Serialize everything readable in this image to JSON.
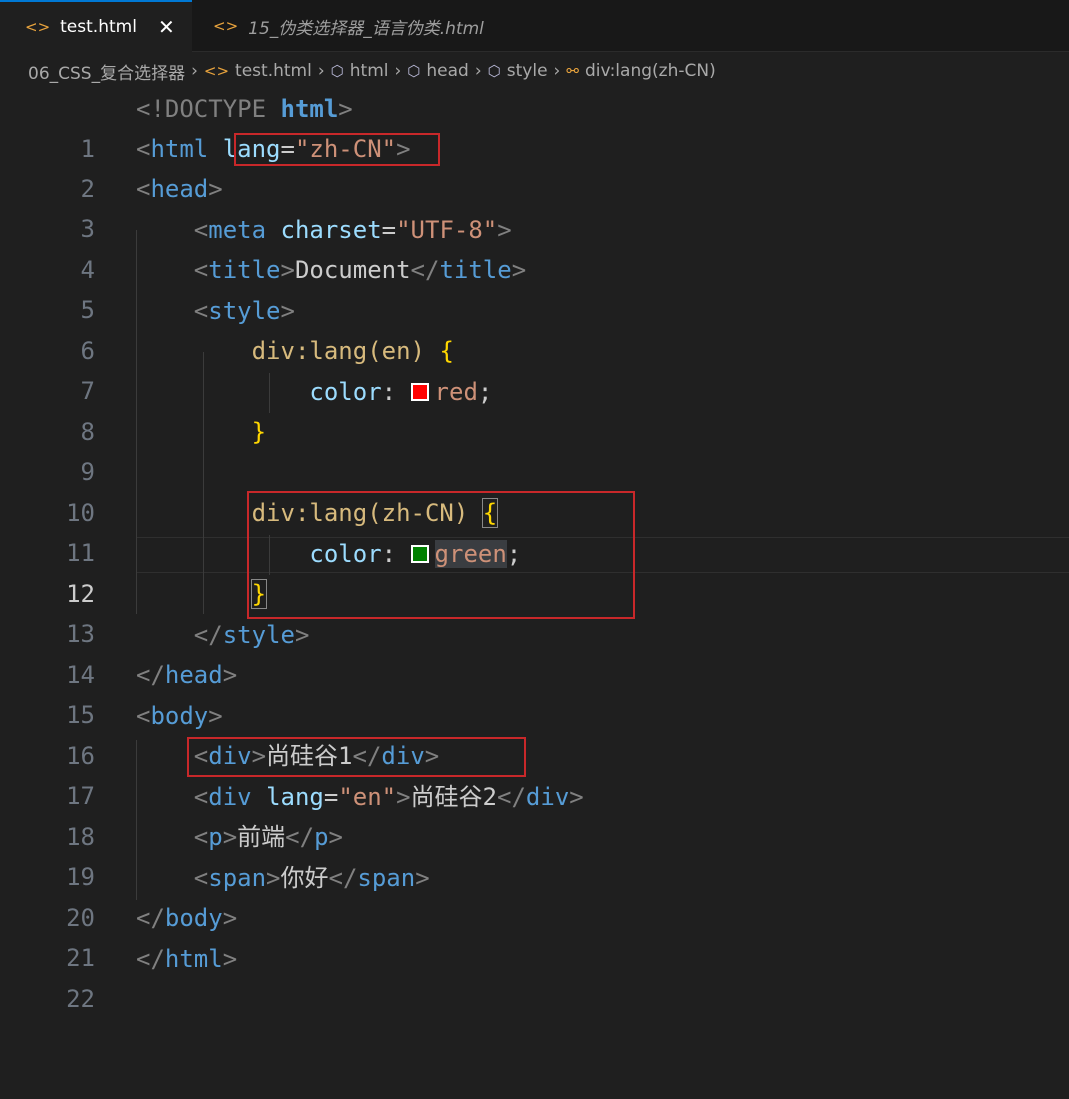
{
  "tabs": [
    {
      "label": "test.html",
      "active": true,
      "icon": "html-file-icon"
    },
    {
      "label": "15_伪类选择器_语言伪类.html",
      "active": false,
      "icon": "html-file-icon"
    }
  ],
  "tab_close_glyph": "✕",
  "breadcrumb": {
    "folder": "06_CSS_复合选择器",
    "file": "test.html",
    "html": "html",
    "head": "head",
    "style": "style",
    "selector": "div:lang(zh-CN)"
  },
  "editor": {
    "active_line": 12,
    "line_numbers": [
      "1",
      "2",
      "3",
      "4",
      "5",
      "6",
      "7",
      "8",
      "9",
      "10",
      "11",
      "12",
      "13",
      "14",
      "15",
      "16",
      "17",
      "18",
      "19",
      "20",
      "21",
      "22"
    ],
    "tokens": {
      "doctype": "<!DOCTYPE",
      "html": "html",
      "lang_attr": "lang",
      "lang_zh": "\"zh-CN\"",
      "head": "head",
      "meta": "meta",
      "charset_attr": "charset",
      "charset_val": "\"UTF-8\"",
      "title": "title",
      "title_text": "Document",
      "style": "style",
      "sel1": "div:lang(en)",
      "sel2": "div:lang(zh-CN)",
      "color_prop": "color",
      "red": "red",
      "green": "green",
      "body": "body",
      "div": "div",
      "text1": "尚硅谷1",
      "lang_en": "\"en\"",
      "text2": "尚硅谷2",
      "p": "p",
      "p_text": "前端",
      "span": "span",
      "span_text": "你好"
    }
  },
  "colors": {
    "swatch_red": "#ff0000",
    "swatch_green": "#008000",
    "highlight_box": "#c8282a"
  }
}
